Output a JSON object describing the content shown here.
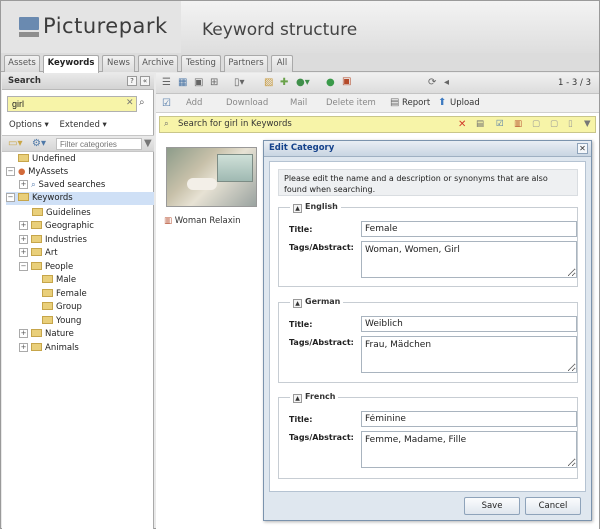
{
  "header": {
    "logo": "Picturepark",
    "title": "Keyword structure"
  },
  "tabs": [
    {
      "label": "Assets"
    },
    {
      "label": "Keywords"
    },
    {
      "label": "News"
    },
    {
      "label": "Archive"
    },
    {
      "label": "Testing"
    },
    {
      "label": "Partners"
    },
    {
      "label": "All"
    }
  ],
  "left": {
    "search_title": "Search",
    "help": "?",
    "collapse": "«",
    "search_value": "girl",
    "options": "Options ▾",
    "extended": "Extended ▾",
    "filter_placeholder": "Filter categories",
    "tree": [
      {
        "label": "Undefined"
      },
      {
        "label": "MyAssets"
      },
      {
        "label": "Saved searches"
      },
      {
        "label": "Keywords"
      },
      {
        "label": "Guidelines"
      },
      {
        "label": "Geographic"
      },
      {
        "label": "Industries"
      },
      {
        "label": "Art"
      },
      {
        "label": "People"
      },
      {
        "label": "Male"
      },
      {
        "label": "Female"
      },
      {
        "label": "Group"
      },
      {
        "label": "Young"
      },
      {
        "label": "Nature"
      },
      {
        "label": "Animals"
      }
    ]
  },
  "main": {
    "pager": "1 - 3 / 3",
    "tb2": {
      "add": "Add",
      "download": "Download",
      "mail": "Mail",
      "delete": "Delete item",
      "report": "Report",
      "upload": "Upload"
    },
    "search_bar": "Search for girl in Keywords",
    "asset_caption": "Woman Relaxin"
  },
  "dialog": {
    "title": "Edit Category",
    "intro": "Please edit the name and a description or synonyms that are also found when searching.",
    "title_label": "Title:",
    "tags_label": "Tags/Abstract:",
    "sections": [
      {
        "legend": "English",
        "title": "Female",
        "tags": "Woman, Women, Girl"
      },
      {
        "legend": "German",
        "title": "Weiblich",
        "tags": "Frau, Mädchen"
      },
      {
        "legend": "French",
        "title": "Féminine",
        "tags": "Femme, Madame, Fille"
      }
    ],
    "save": "Save",
    "cancel": "Cancel"
  }
}
